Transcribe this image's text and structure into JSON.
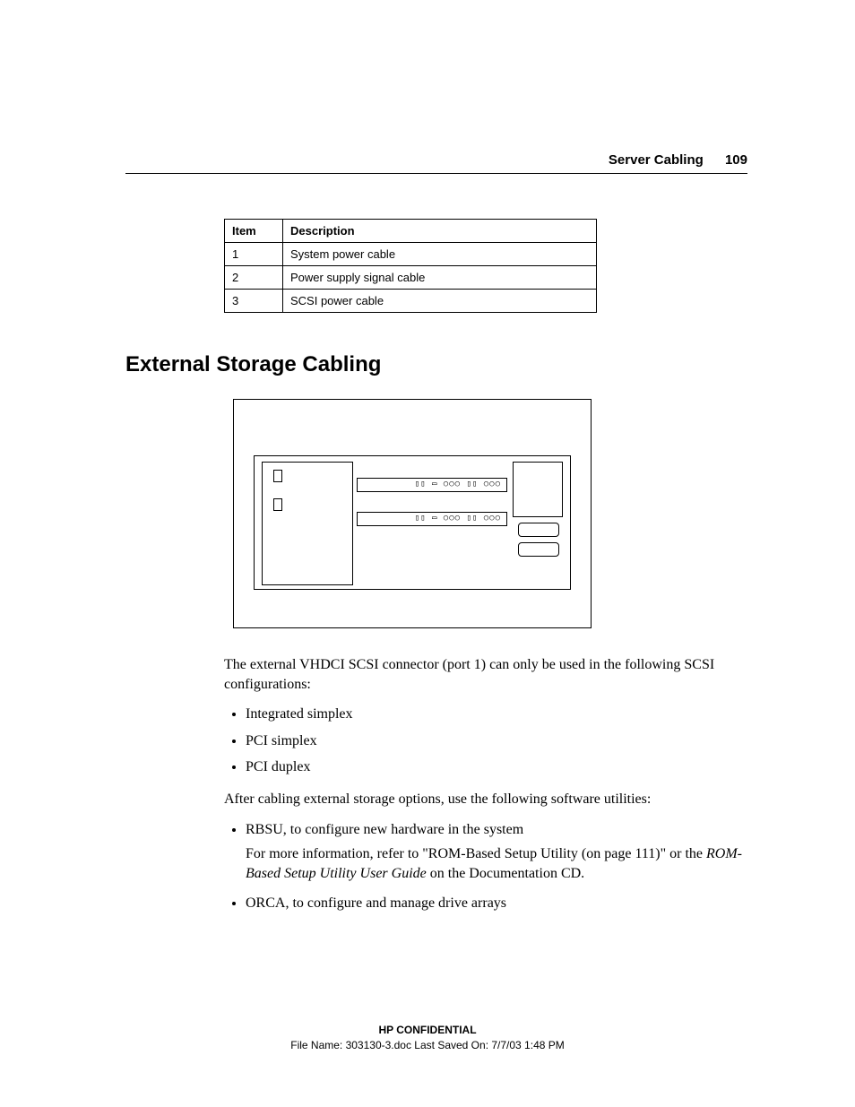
{
  "header": {
    "section": "Server Cabling",
    "page": "109"
  },
  "table": {
    "headers": {
      "item": "Item",
      "desc": "Description"
    },
    "rows": [
      {
        "item": "1",
        "desc": "System power cable"
      },
      {
        "item": "2",
        "desc": "Power supply signal cable"
      },
      {
        "item": "3",
        "desc": "SCSI power cable"
      }
    ]
  },
  "heading": "External Storage Cabling",
  "body": {
    "p1": "The external VHDCI SCSI connector (port 1) can only be used in the following SCSI configurations:",
    "list1": [
      "Integrated simplex",
      "PCI simplex",
      "PCI duplex"
    ],
    "p2": "After cabling external storage options, use the following software utilities:",
    "list2_item1_line1": "RBSU, to configure new hardware in the system",
    "list2_item1_line2a": "For more information, refer to \"ROM-Based Setup Utility (on page 111)\" or the ",
    "list2_item1_line2b": "ROM-Based Setup Utility User Guide",
    "list2_item1_line2c": " on the Documentation CD.",
    "list2_item2": "ORCA, to configure and manage drive arrays"
  },
  "footer": {
    "confidential": "HP CONFIDENTIAL",
    "fileinfo": "File Name: 303130-3.doc   Last Saved On: 7/7/03 1:48 PM"
  }
}
